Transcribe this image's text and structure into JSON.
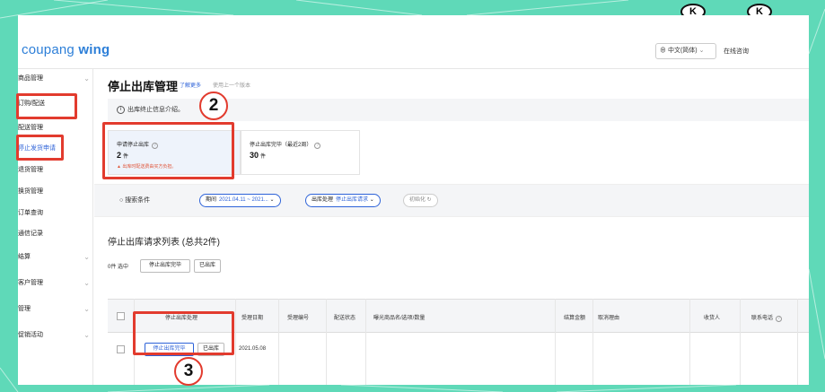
{
  "header": {
    "logo_brand": "coupang",
    "logo_product": "wing",
    "language": "中文(简体)",
    "consult": "在线咨询"
  },
  "sidebar": {
    "items": [
      {
        "label": "商品管理"
      },
      {
        "label": "订购/配送"
      },
      {
        "label": "配送管理"
      },
      {
        "label": "停止发货申请"
      },
      {
        "label": "退货管理"
      },
      {
        "label": "换货管理"
      },
      {
        "label": "订单查询"
      },
      {
        "label": "通信记录"
      },
      {
        "label": "结算"
      },
      {
        "label": "客户管理"
      },
      {
        "label": "管理"
      },
      {
        "label": "促销活动"
      }
    ]
  },
  "page": {
    "title": "停止出库管理",
    "learn_more": "了解更多",
    "prev_version": "使用上一个版本",
    "info": "出库终止信息介绍。"
  },
  "cards": [
    {
      "label": "申请停止出库",
      "value": "2",
      "unit": "件",
      "warning": "▲ 出库时配送费由买方负担。"
    },
    {
      "label": "停止出库完毕（最近2周）",
      "value": "30",
      "unit": "件"
    }
  ],
  "search": {
    "label": "搜索条件",
    "period_label": "期间",
    "period_value": "2021.04.11 ~ 2021...",
    "status_label": "出库处理",
    "status_value": "停止出库请求",
    "reset_label": "初始化"
  },
  "list": {
    "title": "停止出库请求列表 (总共2件)",
    "selected": "0件 选中",
    "btn_done": "停止出库完毕",
    "btn_shipped": "已出库"
  },
  "table": {
    "headers": [
      "停止出库处理",
      "受理日期",
      "受理编号",
      "配送状态",
      "曝光商品名/选项/数量",
      "结算金额",
      "取消理由",
      "收货人",
      "联系电话"
    ],
    "rows": [
      {
        "btn_done": "停止出库完毕",
        "btn_shipped": "已出库",
        "date": "2021.05.08"
      }
    ]
  },
  "annotations": {
    "step2": "2",
    "step3": "3"
  },
  "colors": {
    "highlight": "#e23b2e",
    "accent": "#2d62d8",
    "backdrop": "#5fd9b8"
  }
}
